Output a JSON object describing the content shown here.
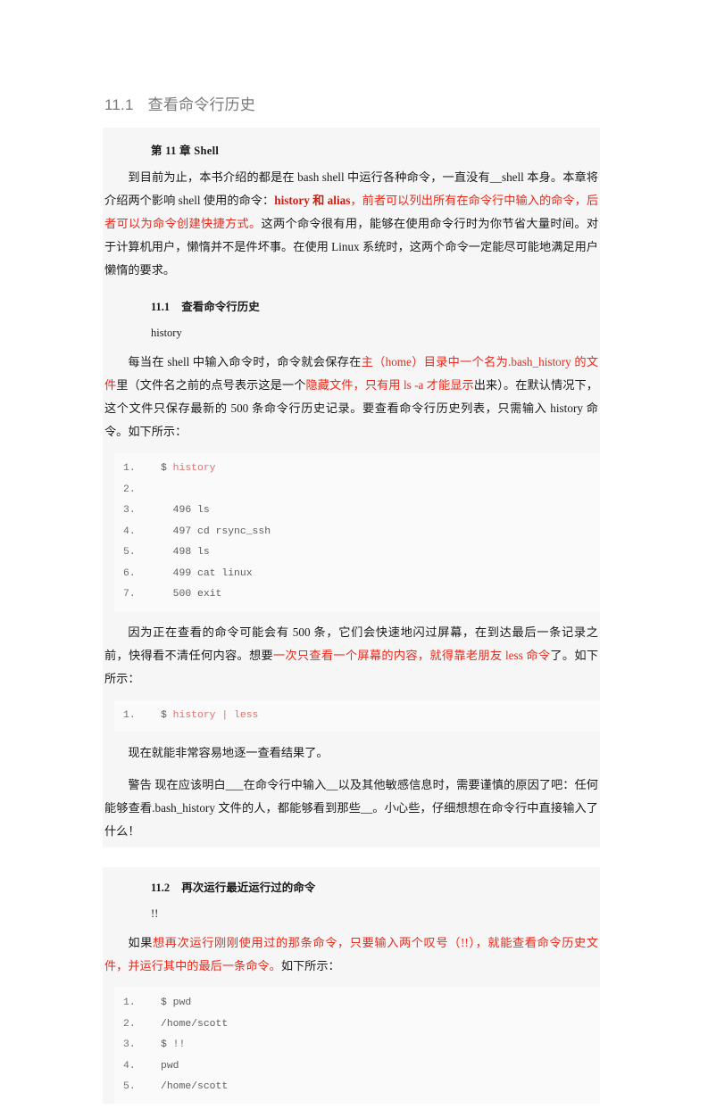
{
  "page": {
    "title_number": "11.1",
    "title_text": "查看命令行历史"
  },
  "document": {
    "chapter_heading": "第 11 章 Shell",
    "intro_paragraph": {
      "seg1": "到目前为止，本书介绍的都是在 bash shell 中运行各种命令，一直没有__shell 本身。本章将介绍两个影响 shell 使用的命令：",
      "seg2_red_bold": "history 和 alias",
      "seg3": "，",
      "seg4_red": "前者可以列出所有在命令行中输入的命令，后者可以为命令创建快捷方式。",
      "seg5": "这两个命令很有用，能够在使用命令行时为你节省大量时间。对于计算机用户，懒惰并不是件坏事。在使用 Linux 系统时，这两个命令一定能尽可能地满足用户懒惰的要求。"
    },
    "section_11_1": {
      "number": "11.1",
      "title": "查看命令行历史",
      "term": "history",
      "paragraph": {
        "seg1": "每当在 shell 中输入命令时，命令就会保存在",
        "seg2_red": "主（home）目录中一个名为.bash_history 的文件",
        "seg3": "里（文件名之前的点号表示这是一个",
        "seg4_red": "隐藏文件，只有用 ls -a 才能显示",
        "seg5": "出来）。在默认情况下，这个文件只保存最新的 500 条命令行历史记录。要查看命令行历史列表，只需输入 history 命令。如下所示："
      },
      "code_history": [
        {
          "num": "1.",
          "prompt": "$ ",
          "keyword": "history",
          "rest": ""
        },
        {
          "num": "2.",
          "prompt": "",
          "keyword": "",
          "rest": ""
        },
        {
          "num": "3.",
          "prompt": "",
          "keyword": "",
          "rest": "  496 ls"
        },
        {
          "num": "4.",
          "prompt": "",
          "keyword": "",
          "rest": "  497 cd rsync_ssh"
        },
        {
          "num": "5.",
          "prompt": "",
          "keyword": "",
          "rest": "  498 ls"
        },
        {
          "num": "6.",
          "prompt": "",
          "keyword": "",
          "rest": "  499 cat linux"
        },
        {
          "num": "7.",
          "prompt": "",
          "keyword": "",
          "rest": "  500 exit"
        }
      ],
      "paragraph2": {
        "seg1": "因为正在查看的命令可能会有 500 条，它们会快速地闪过屏幕，在到达最后一条记录之前，快得看不清任何内容。想要",
        "seg2_red": "一次只查看一个屏幕的内容，就得靠老朋友 less 命令",
        "seg3": "了。如下所示："
      },
      "code_less": [
        {
          "num": "1.",
          "prompt": "$ ",
          "keyword": "history | less",
          "rest": ""
        }
      ],
      "paragraph3": "现在就能非常容易地逐一查看结果了。",
      "warning": "警告 现在应该明白___在命令行中输入__以及其他敏感信息时，需要谨慎的原因了吧：任何能够查看.bash_history 文件的人，都能够看到那些__。小心些，仔细想想在命令行中直接输入了什么！"
    },
    "section_11_2": {
      "number": "11.2",
      "title": "再次运行最近运行过的命令",
      "term": "!!",
      "paragraph": {
        "seg1": "如果",
        "seg2_red": "想再次运行刚刚使用过的那条命令，只要输入两个叹号（!!），就能查看命令历史文件，并运行其中的最后一条命令。",
        "seg3": "如下所示："
      },
      "code_bang": [
        {
          "num": "1.",
          "prompt": "",
          "keyword": "",
          "rest": "$ pwd"
        },
        {
          "num": "2.",
          "prompt": "",
          "keyword": "",
          "rest": "/home/scott"
        },
        {
          "num": "3.",
          "prompt": "",
          "keyword": "",
          "rest": "$ !!"
        },
        {
          "num": "4.",
          "prompt": "",
          "keyword": "",
          "rest": "pwd"
        },
        {
          "num": "5.",
          "prompt": "",
          "keyword": "",
          "rest": "/home/scott"
        }
      ]
    }
  },
  "colors": {
    "accent_red": "#e8291c",
    "code_keyword": "#e0726c",
    "page_title": "#7a7a7a",
    "block_bg": "#f6f6f6",
    "code_bg": "#fafafa"
  }
}
